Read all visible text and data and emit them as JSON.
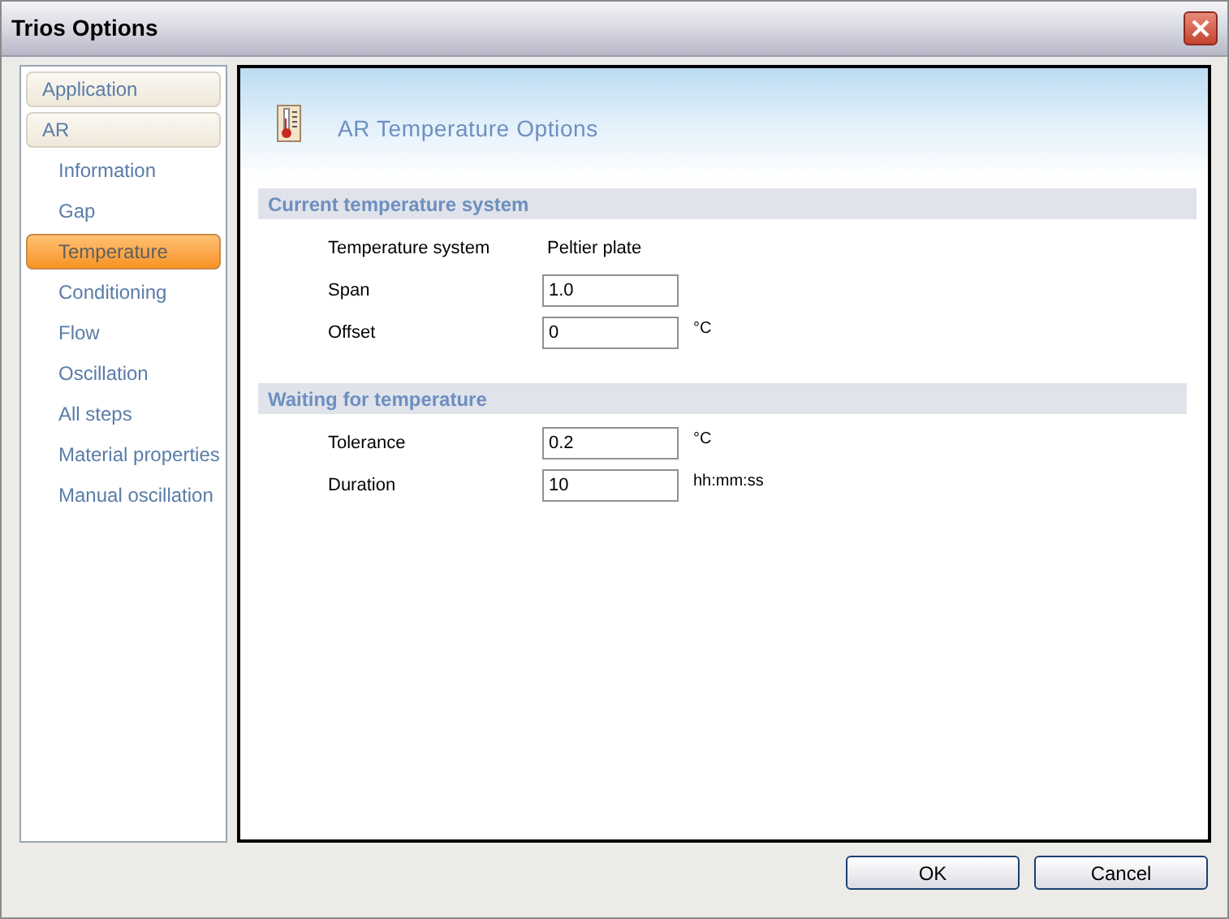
{
  "window": {
    "title": "Trios Options"
  },
  "sidebar": {
    "items": [
      {
        "label": "Application",
        "kind": "group",
        "selected": false
      },
      {
        "label": "AR",
        "kind": "group",
        "selected": false
      },
      {
        "label": "Information",
        "kind": "page",
        "selected": false
      },
      {
        "label": "Gap",
        "kind": "page",
        "selected": false
      },
      {
        "label": "Temperature",
        "kind": "page",
        "selected": true
      },
      {
        "label": "Conditioning",
        "kind": "page",
        "selected": false
      },
      {
        "label": "Flow",
        "kind": "page",
        "selected": false
      },
      {
        "label": "Oscillation",
        "kind": "page",
        "selected": false
      },
      {
        "label": "All steps",
        "kind": "page",
        "selected": false
      },
      {
        "label": "Material properties",
        "kind": "page",
        "selected": false
      },
      {
        "label": "Manual oscillation",
        "kind": "page",
        "selected": false
      }
    ]
  },
  "page": {
    "title": "AR Temperature Options",
    "sections": [
      {
        "title": "Current temperature system",
        "rows": [
          {
            "label": "Temperature system",
            "kind": "text",
            "value": "Peltier plate"
          },
          {
            "label": "Span",
            "kind": "input",
            "value": "1.0"
          },
          {
            "label": "Offset",
            "kind": "input",
            "value": "0",
            "unit": "°C"
          }
        ]
      },
      {
        "title": "Waiting for temperature",
        "rows": [
          {
            "label": "Tolerance",
            "kind": "input",
            "value": "0.2",
            "unit": "°C"
          },
          {
            "label": "Duration",
            "kind": "input",
            "value": "10",
            "unit": "hh:mm:ss"
          }
        ]
      }
    ]
  },
  "buttons": [
    "OK",
    "Cancel"
  ]
}
